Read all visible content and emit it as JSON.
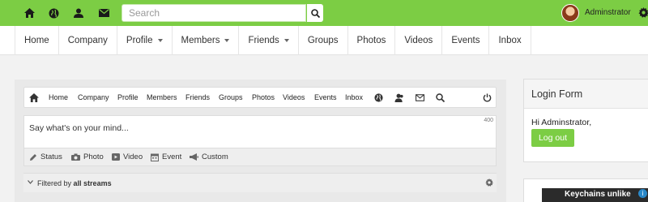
{
  "topbar": {
    "icons": [
      "home-icon",
      "globe-icon",
      "user-icon",
      "mail-icon"
    ],
    "search_placeholder": "Search",
    "username": "Adminstrator",
    "accent": "#7ccd44"
  },
  "mainnav": {
    "items": [
      {
        "label": "Home"
      },
      {
        "label": "Company"
      },
      {
        "label": "Profile"
      },
      {
        "label": "Members"
      },
      {
        "label": "Friends"
      },
      {
        "label": "Groups"
      },
      {
        "label": "Photos"
      },
      {
        "label": "Videos"
      },
      {
        "label": "Events"
      },
      {
        "label": "Inbox"
      }
    ]
  },
  "stream": {
    "toolbar": [
      "Home",
      "Company",
      "Profile",
      "Members",
      "Friends",
      "Groups",
      "Photos",
      "Videos",
      "Events",
      "Inbox"
    ],
    "composer_placeholder": "Say what's on your mind...",
    "char_count": "400",
    "attachments": [
      "Status",
      "Photo",
      "Video",
      "Event",
      "Custom"
    ],
    "filter_prefix": "Filtered by",
    "filter_value": "all streams"
  },
  "login": {
    "title": "Login Form",
    "greeting": "Hi Adminstrator,",
    "logout_label": "Log out"
  },
  "ad": {
    "text": "Keychains unlike",
    "info": "i"
  }
}
